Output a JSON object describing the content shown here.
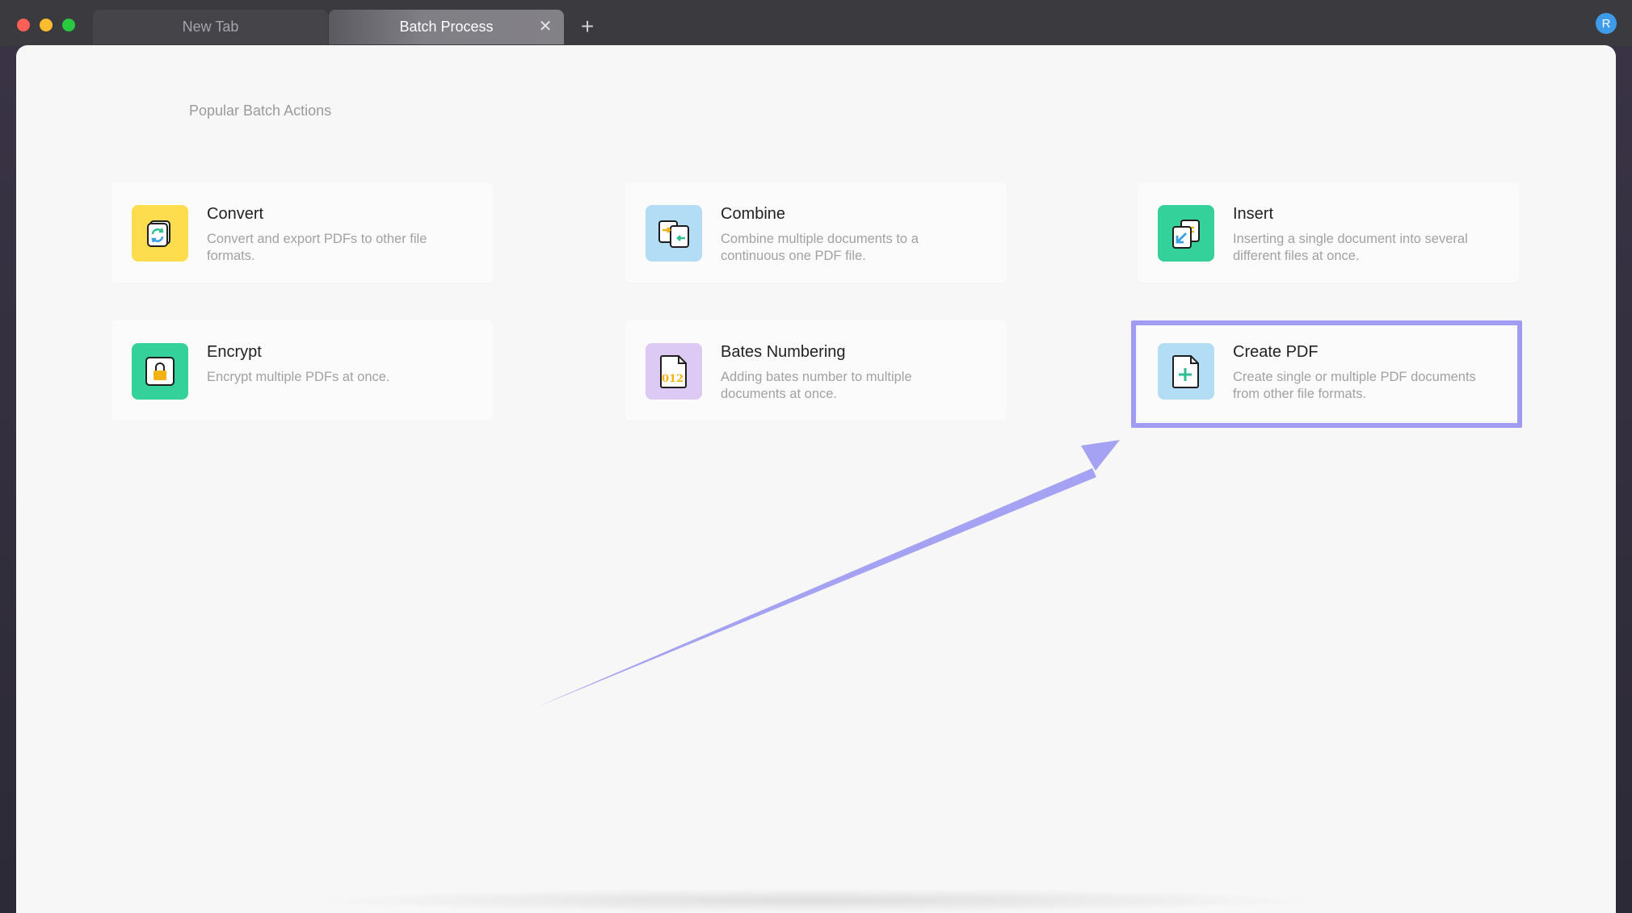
{
  "tabs": [
    {
      "label": "New Tab"
    },
    {
      "label": "Batch Process"
    }
  ],
  "avatar_initial": "R",
  "section_title": "Popular Batch Actions",
  "actions": [
    {
      "title": "Convert",
      "desc": "Convert and export PDFs to other file formats.",
      "icon": "convert-icon"
    },
    {
      "title": "Combine",
      "desc": "Combine multiple documents to a continuous one PDF file.",
      "icon": "combine-icon"
    },
    {
      "title": "Insert",
      "desc": "Inserting a single document into several different files at once.",
      "icon": "insert-icon"
    },
    {
      "title": "Encrypt",
      "desc": "Encrypt multiple PDFs at once.",
      "icon": "lock-icon"
    },
    {
      "title": "Bates Numbering",
      "desc": "Adding bates number to multiple documents at once.",
      "icon": "bates-numbering-icon",
      "icon_text": "012"
    },
    {
      "title": "Create PDF",
      "desc": "Create single or multiple PDF documents from other file formats.",
      "icon": "create-pdf-icon"
    }
  ],
  "colors": {
    "highlight": "#9f9cf2",
    "arrow": "#a5a2f4",
    "convert": "#fddc4e",
    "combine": "#b3dcf5",
    "insert": "#35d19a",
    "encrypt": "#35d19a",
    "bates": "#dcc9f4",
    "create": "#b3dcf5"
  }
}
